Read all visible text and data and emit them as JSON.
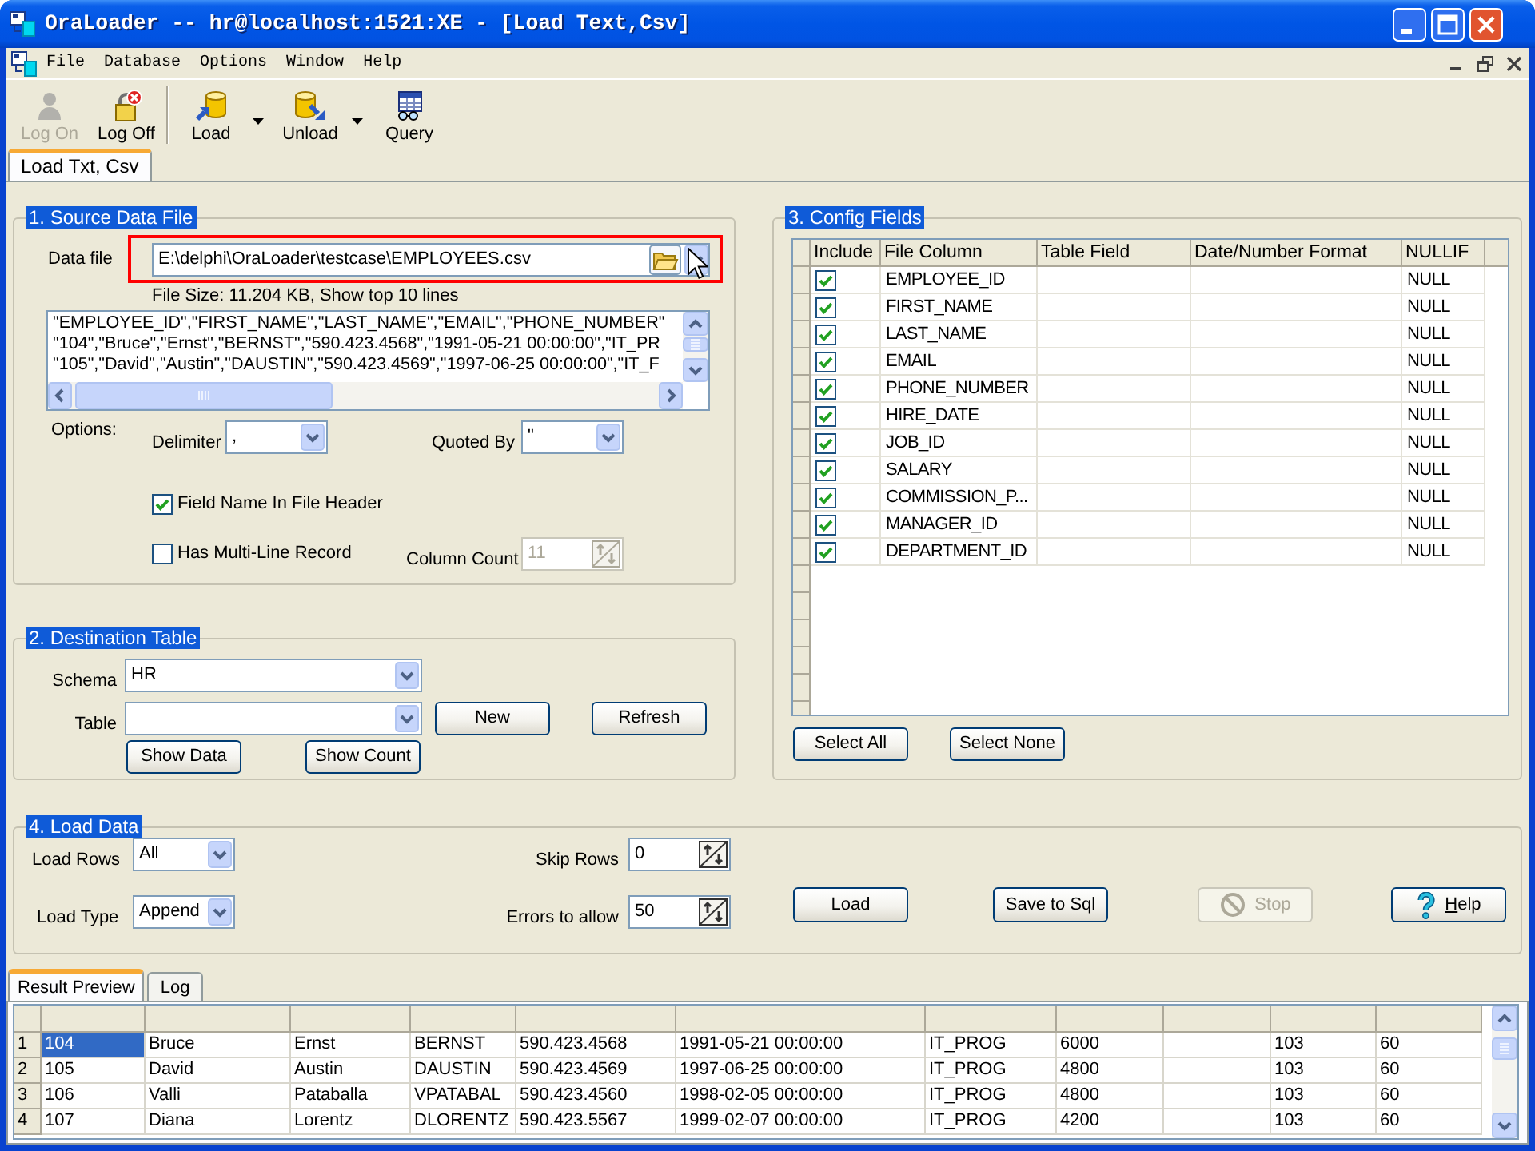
{
  "window": {
    "title": "OraLoader -- hr@localhost:1521:XE - [Load Text,Csv]"
  },
  "menu": [
    "File",
    "Database",
    "Options",
    "Window",
    "Help"
  ],
  "toolbar": [
    {
      "label": "Log On",
      "disabled": true,
      "dropdown": false
    },
    {
      "label": "Log Off",
      "disabled": false,
      "dropdown": false
    },
    {
      "label": "Load",
      "disabled": false,
      "dropdown": true
    },
    {
      "label": "Unload",
      "disabled": false,
      "dropdown": true
    },
    {
      "label": "Query",
      "disabled": false,
      "dropdown": false
    }
  ],
  "tabs": [
    {
      "label": "Load Txt, Csv",
      "selected": true
    }
  ],
  "source": {
    "title": "1. Source Data File",
    "data_file": {
      "label": "Data file",
      "value": "E:\\delphi\\OraLoader\\testcase\\EMPLOYEES.csv",
      "highlighted": true
    },
    "file_info": "File Size: 11.204 KB, Show top 10 lines",
    "preview_lines": [
      "\"EMPLOYEE_ID\",\"FIRST_NAME\",\"LAST_NAME\",\"EMAIL\",\"PHONE_NUMBER\"",
      "\"104\",\"Bruce\",\"Ernst\",\"BERNST\",\"590.423.4568\",\"1991-05-21 00:00:00\",\"IT_PR",
      "\"105\",\"David\",\"Austin\",\"DAUSTIN\",\"590.423.4569\",\"1997-06-25 00:00:00\",\"IT_F"
    ],
    "options_label": "Options:",
    "delimiter": {
      "label": "Delimiter",
      "value": ","
    },
    "quoted_by": {
      "label": "Quoted By",
      "value": "\""
    },
    "field_name_in_header": {
      "label": "Field Name In File Header",
      "checked": true
    },
    "multi_line_record": {
      "label": "Has Multi-Line Record",
      "checked": false
    },
    "column_count": {
      "label": "Column Count",
      "value": "11",
      "disabled": true
    }
  },
  "destination": {
    "title": "2. Destination Table",
    "schema": {
      "label": "Schema",
      "value": "HR"
    },
    "table": {
      "label": "Table"
    },
    "buttons": [
      "New",
      "Refresh",
      "Show Data",
      "Show Count"
    ]
  },
  "config": {
    "title": "3. Config Fields",
    "columns": [
      "Include",
      "File Column",
      "Table Field",
      "Date/Number Format",
      "NULLIF"
    ],
    "rows": [
      {
        "include": true,
        "file_column": "EMPLOYEE_ID",
        "nullif": "NULL"
      },
      {
        "include": true,
        "file_column": "FIRST_NAME",
        "nullif": "NULL"
      },
      {
        "include": true,
        "file_column": "LAST_NAME",
        "nullif": "NULL"
      },
      {
        "include": true,
        "file_column": "EMAIL",
        "nullif": "NULL"
      },
      {
        "include": true,
        "file_column": "PHONE_NUMBER",
        "nullif": "NULL"
      },
      {
        "include": true,
        "file_column": "HIRE_DATE",
        "nullif": "NULL"
      },
      {
        "include": true,
        "file_column": "JOB_ID",
        "nullif": "NULL"
      },
      {
        "include": true,
        "file_column": "SALARY",
        "nullif": "NULL"
      },
      {
        "include": true,
        "file_column": "COMMISSION_P...",
        "nullif": "NULL"
      },
      {
        "include": true,
        "file_column": "MANAGER_ID",
        "nullif": "NULL"
      },
      {
        "include": true,
        "file_column": "DEPARTMENT_ID",
        "nullif": "NULL"
      }
    ],
    "buttons": [
      "Select All",
      "Select None"
    ]
  },
  "load": {
    "title": "4. Load Data",
    "load_rows": {
      "label": "Load Rows",
      "value": "All"
    },
    "load_type": {
      "label": "Load Type",
      "value": "Append"
    },
    "skip_rows": {
      "label": "Skip Rows",
      "value": "0"
    },
    "errors_to_allow": {
      "label": "Errors to allow",
      "value": "50"
    },
    "buttons": [
      {
        "label": "Load",
        "disabled": false,
        "mnemonic": false
      },
      {
        "label": "Save to Sql",
        "disabled": false,
        "mnemonic": false
      },
      {
        "label": "Stop",
        "disabled": true,
        "mnemonic": false
      },
      {
        "label": "Help",
        "disabled": false,
        "mnemonic": true
      }
    ]
  },
  "results": {
    "tabs": [
      {
        "label": "Result Preview",
        "selected": true
      },
      {
        "label": "Log",
        "selected": false
      }
    ],
    "rows": [
      {
        "number": "1",
        "cells": [
          {
            "text": "104",
            "selected": true
          },
          {
            "text": "Bruce",
            "selected": false
          },
          {
            "text": "Ernst",
            "selected": false
          },
          {
            "text": "BERNST",
            "selected": false
          },
          {
            "text": "590.423.4568",
            "selected": false
          },
          {
            "text": "1991-05-21 00:00:00",
            "selected": false
          },
          {
            "text": "IT_PROG",
            "selected": false
          },
          {
            "text": "6000",
            "selected": false
          },
          {
            "selected": false
          },
          {
            "text": "103",
            "selected": false
          },
          {
            "text": "60",
            "selected": false
          }
        ]
      },
      {
        "number": "2",
        "cells": [
          {
            "text": "105",
            "selected": false
          },
          {
            "text": "David",
            "selected": false
          },
          {
            "text": "Austin",
            "selected": false
          },
          {
            "text": "DAUSTIN",
            "selected": false
          },
          {
            "text": "590.423.4569",
            "selected": false
          },
          {
            "text": "1997-06-25 00:00:00",
            "selected": false
          },
          {
            "text": "IT_PROG",
            "selected": false
          },
          {
            "text": "4800",
            "selected": false
          },
          {
            "selected": false
          },
          {
            "text": "103",
            "selected": false
          },
          {
            "text": "60",
            "selected": false
          }
        ]
      },
      {
        "number": "3",
        "cells": [
          {
            "text": "106",
            "selected": false
          },
          {
            "text": "Valli",
            "selected": false
          },
          {
            "text": "Pataballa",
            "selected": false
          },
          {
            "text": "VPATABAL",
            "selected": false
          },
          {
            "text": "590.423.4560",
            "selected": false
          },
          {
            "text": "1998-02-05 00:00:00",
            "selected": false
          },
          {
            "text": "IT_PROG",
            "selected": false
          },
          {
            "text": "4800",
            "selected": false
          },
          {
            "selected": false
          },
          {
            "text": "103",
            "selected": false
          },
          {
            "text": "60",
            "selected": false
          }
        ]
      },
      {
        "number": "4",
        "cells": [
          {
            "text": "107",
            "selected": false
          },
          {
            "text": "Diana",
            "selected": false
          },
          {
            "text": "Lorentz",
            "selected": false
          },
          {
            "text": "DLORENTZ",
            "selected": false
          },
          {
            "text": "590.423.5567",
            "selected": false
          },
          {
            "text": "1999-02-07 00:00:00",
            "selected": false
          },
          {
            "text": "IT_PROG",
            "selected": false
          },
          {
            "text": "4200",
            "selected": false
          },
          {
            "selected": false
          },
          {
            "text": "103",
            "selected": false
          },
          {
            "text": "60",
            "selected": false
          }
        ]
      }
    ]
  }
}
